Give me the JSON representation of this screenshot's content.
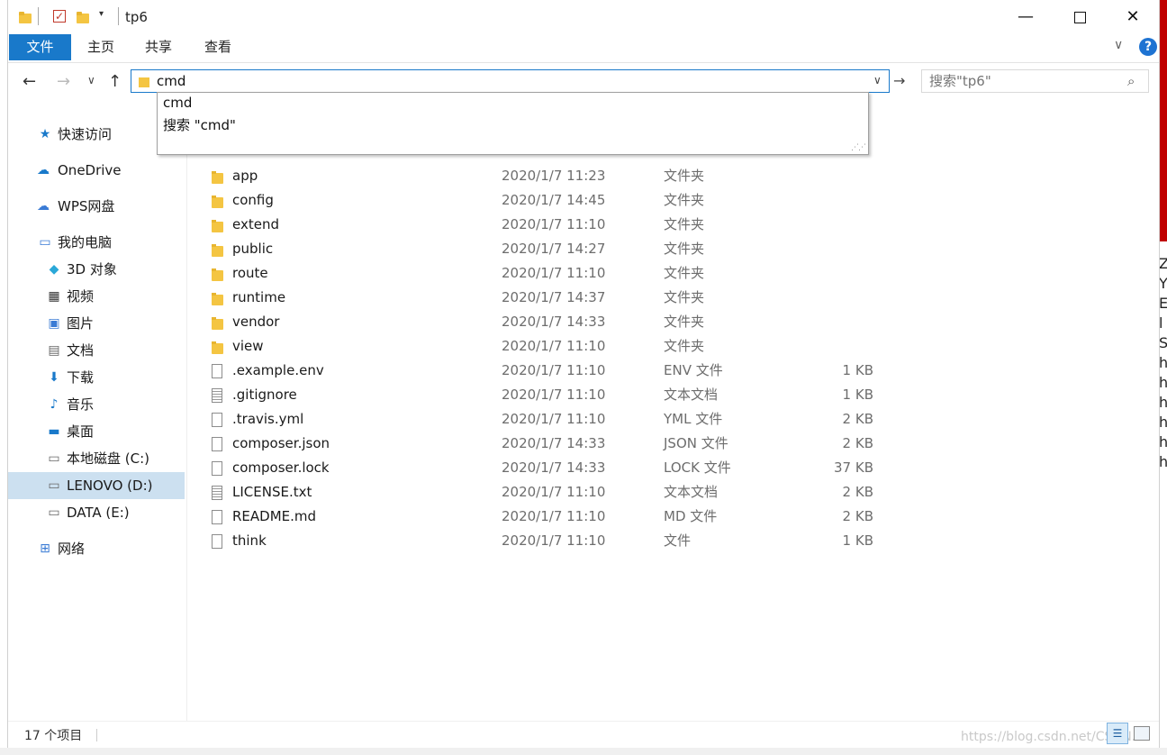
{
  "window": {
    "title": "tp6",
    "controls": {
      "minimize": "—",
      "maximize": "",
      "close": "✕"
    }
  },
  "ribbon": {
    "tabs": [
      {
        "label": "文件",
        "active": true
      },
      {
        "label": "主页"
      },
      {
        "label": "共享"
      },
      {
        "label": "查看"
      }
    ],
    "help": "?"
  },
  "nav": {
    "address_value": "cmd",
    "search_placeholder": "搜索\"tp6\""
  },
  "autocomplete": {
    "items": [
      "cmd",
      "搜索 \"cmd\""
    ]
  },
  "sidebar": {
    "items": [
      {
        "label": "快速访问",
        "icon": "star-icon"
      },
      {
        "label": "OneDrive",
        "icon": "cloud-icon"
      },
      {
        "label": "WPS网盘",
        "icon": "cloud-outline-icon"
      },
      {
        "label": "我的电脑",
        "icon": "computer-icon"
      },
      {
        "label": "3D 对象",
        "icon": "cube-icon"
      },
      {
        "label": "视频",
        "icon": "film-icon"
      },
      {
        "label": "图片",
        "icon": "picture-icon"
      },
      {
        "label": "文档",
        "icon": "document-icon"
      },
      {
        "label": "下载",
        "icon": "download-icon"
      },
      {
        "label": "音乐",
        "icon": "music-icon"
      },
      {
        "label": "桌面",
        "icon": "desktop-icon"
      },
      {
        "label": "本地磁盘 (C:)",
        "icon": "drive-icon"
      },
      {
        "label": "LENOVO (D:)",
        "icon": "drive-icon",
        "selected": true
      },
      {
        "label": "DATA (E:)",
        "icon": "drive-icon"
      },
      {
        "label": "网络",
        "icon": "network-icon"
      }
    ]
  },
  "files": {
    "rows": [
      {
        "name": "app",
        "date": "2020/1/7 11:23",
        "type": "文件夹",
        "size": "",
        "kind": "folder"
      },
      {
        "name": "config",
        "date": "2020/1/7 14:45",
        "type": "文件夹",
        "size": "",
        "kind": "folder"
      },
      {
        "name": "extend",
        "date": "2020/1/7 11:10",
        "type": "文件夹",
        "size": "",
        "kind": "folder"
      },
      {
        "name": "public",
        "date": "2020/1/7 14:27",
        "type": "文件夹",
        "size": "",
        "kind": "folder"
      },
      {
        "name": "route",
        "date": "2020/1/7 11:10",
        "type": "文件夹",
        "size": "",
        "kind": "folder"
      },
      {
        "name": "runtime",
        "date": "2020/1/7 14:37",
        "type": "文件夹",
        "size": "",
        "kind": "folder"
      },
      {
        "name": "vendor",
        "date": "2020/1/7 14:33",
        "type": "文件夹",
        "size": "",
        "kind": "folder"
      },
      {
        "name": "view",
        "date": "2020/1/7 11:10",
        "type": "文件夹",
        "size": "",
        "kind": "folder"
      },
      {
        "name": ".example.env",
        "date": "2020/1/7 11:10",
        "type": "ENV 文件",
        "size": "1 KB",
        "kind": "file"
      },
      {
        "name": ".gitignore",
        "date": "2020/1/7 11:10",
        "type": "文本文档",
        "size": "1 KB",
        "kind": "text"
      },
      {
        "name": ".travis.yml",
        "date": "2020/1/7 11:10",
        "type": "YML 文件",
        "size": "2 KB",
        "kind": "file"
      },
      {
        "name": "composer.json",
        "date": "2020/1/7 14:33",
        "type": "JSON 文件",
        "size": "2 KB",
        "kind": "file"
      },
      {
        "name": "composer.lock",
        "date": "2020/1/7 14:33",
        "type": "LOCK 文件",
        "size": "37 KB",
        "kind": "file"
      },
      {
        "name": "LICENSE.txt",
        "date": "2020/1/7 11:10",
        "type": "文本文档",
        "size": "2 KB",
        "kind": "text"
      },
      {
        "name": "README.md",
        "date": "2020/1/7 11:10",
        "type": "MD 文件",
        "size": "2 KB",
        "kind": "file"
      },
      {
        "name": "think",
        "date": "2020/1/7 11:10",
        "type": "文件",
        "size": "1 KB",
        "kind": "file"
      }
    ]
  },
  "status": {
    "count": "17 个项目",
    "watermark": "https://blog.csdn.net/CSDN..."
  },
  "background": {
    "right_letters": [
      "Z",
      "Y",
      "E",
      "l",
      "S",
      "h",
      "h",
      "h",
      "h",
      "h",
      "h"
    ]
  },
  "colors": {
    "accent": "#1979ca",
    "selection": "#cce0f0",
    "folder": "#f4c542"
  }
}
